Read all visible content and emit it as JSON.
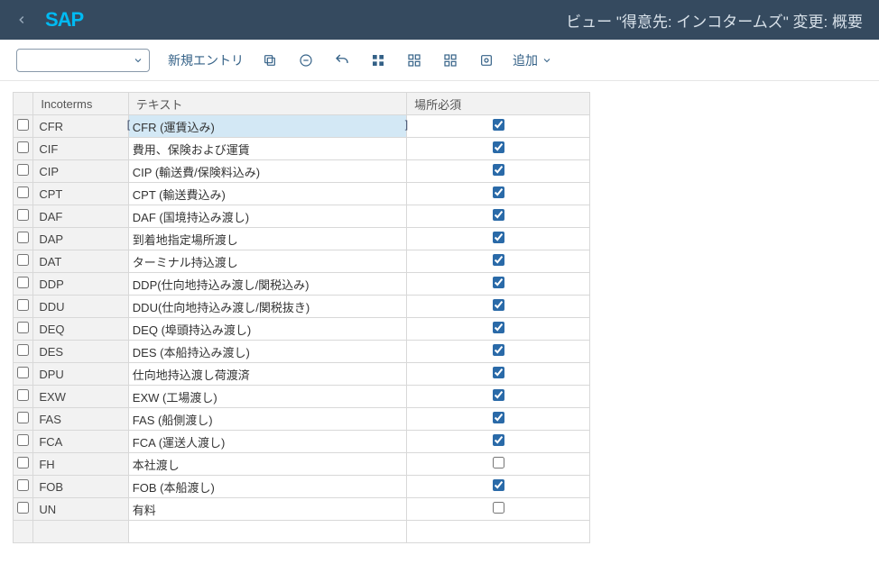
{
  "header": {
    "title": "ビュー \"得意先: インコタームズ\" 変更: 概要",
    "logo": "SAP"
  },
  "toolbar": {
    "new_entry": "新規エントリ",
    "add_label": "追加"
  },
  "table": {
    "headers": {
      "incoterms": "Incoterms",
      "text": "テキスト",
      "location": "場所必須"
    },
    "rows": [
      {
        "code": "CFR",
        "text": "CFR (運賃込み)",
        "loc": true,
        "selected": true
      },
      {
        "code": "CIF",
        "text": "費用、保険および運賃",
        "loc": true
      },
      {
        "code": "CIP",
        "text": "CIP (輸送費/保険料込み)",
        "loc": true
      },
      {
        "code": "CPT",
        "text": "CPT (輸送費込み)",
        "loc": true
      },
      {
        "code": "DAF",
        "text": "DAF (国境持込み渡し)",
        "loc": true
      },
      {
        "code": "DAP",
        "text": "到着地指定場所渡し",
        "loc": true
      },
      {
        "code": "DAT",
        "text": "ターミナル持込渡し",
        "loc": true
      },
      {
        "code": "DDP",
        "text": "DDP(仕向地持込み渡し/関税込み)",
        "loc": true
      },
      {
        "code": "DDU",
        "text": "DDU(仕向地持込み渡し/関税抜き)",
        "loc": true
      },
      {
        "code": "DEQ",
        "text": "DEQ (埠頭持込み渡し)",
        "loc": true
      },
      {
        "code": "DES",
        "text": "DES (本船持込み渡し)",
        "loc": true
      },
      {
        "code": "DPU",
        "text": "仕向地持込渡し荷渡済",
        "loc": true
      },
      {
        "code": "EXW",
        "text": "EXW (工場渡し)",
        "loc": true
      },
      {
        "code": "FAS",
        "text": "FAS (船側渡し)",
        "loc": true
      },
      {
        "code": "FCA",
        "text": "FCA (運送人渡し)",
        "loc": true
      },
      {
        "code": "FH",
        "text": "本社渡し",
        "loc": false
      },
      {
        "code": "FOB",
        "text": "FOB (本船渡し)",
        "loc": true
      },
      {
        "code": "UN",
        "text": "有料",
        "loc": false
      }
    ]
  }
}
